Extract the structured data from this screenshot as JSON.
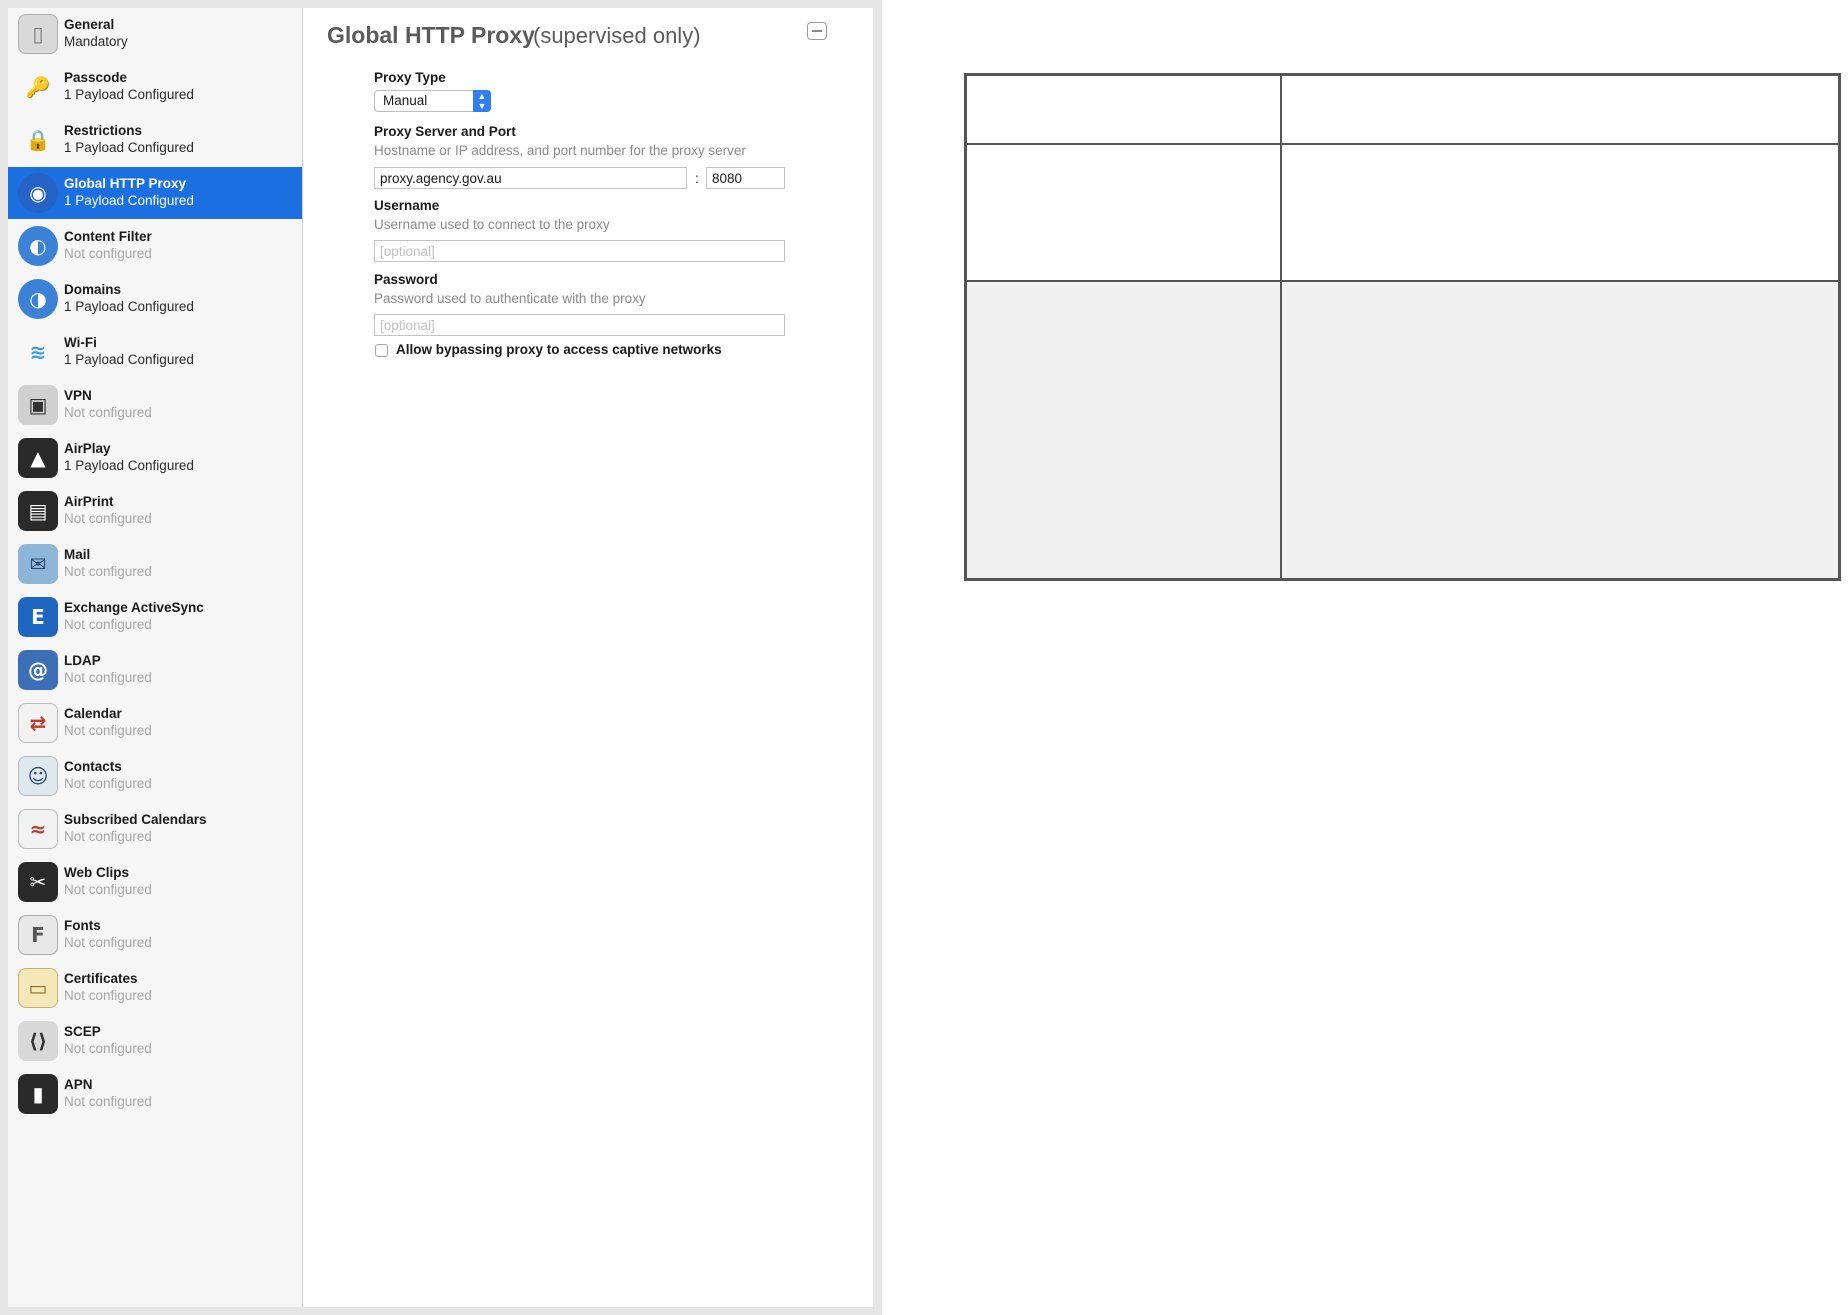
{
  "sidebar": {
    "items": [
      {
        "title": "General",
        "subtitle": "Mandatory",
        "icon": "general-icon",
        "configured": true,
        "selected": false
      },
      {
        "title": "Passcode",
        "subtitle": "1 Payload Configured",
        "icon": "key-icon",
        "configured": true,
        "selected": false
      },
      {
        "title": "Restrictions",
        "subtitle": "1 Payload Configured",
        "icon": "padlock-icon",
        "configured": true,
        "selected": false
      },
      {
        "title": "Global HTTP Proxy",
        "subtitle": "1 Payload Configured",
        "icon": "globe-icon",
        "configured": true,
        "selected": true
      },
      {
        "title": "Content Filter",
        "subtitle": "Not configured",
        "icon": "globe-filter-icon",
        "configured": false,
        "selected": false
      },
      {
        "title": "Domains",
        "subtitle": "1 Payload Configured",
        "icon": "globe-domains-icon",
        "configured": true,
        "selected": false
      },
      {
        "title": "Wi-Fi",
        "subtitle": "1 Payload Configured",
        "icon": "wifi-icon",
        "configured": true,
        "selected": false
      },
      {
        "title": "VPN",
        "subtitle": "Not configured",
        "icon": "vpn-lock-icon",
        "configured": false,
        "selected": false
      },
      {
        "title": "AirPlay",
        "subtitle": "1 Payload Configured",
        "icon": "airplay-icon",
        "configured": true,
        "selected": false
      },
      {
        "title": "AirPrint",
        "subtitle": "Not configured",
        "icon": "printer-icon",
        "configured": false,
        "selected": false
      },
      {
        "title": "Mail",
        "subtitle": "Not configured",
        "icon": "mail-icon",
        "configured": false,
        "selected": false
      },
      {
        "title": "Exchange ActiveSync",
        "subtitle": "Not configured",
        "icon": "exchange-icon",
        "configured": false,
        "selected": false
      },
      {
        "title": "LDAP",
        "subtitle": "Not configured",
        "icon": "ldap-at-icon",
        "configured": false,
        "selected": false
      },
      {
        "title": "Calendar",
        "subtitle": "Not configured",
        "icon": "calendar-icon",
        "configured": false,
        "selected": false
      },
      {
        "title": "Contacts",
        "subtitle": "Not configured",
        "icon": "contacts-icon",
        "configured": false,
        "selected": false
      },
      {
        "title": "Subscribed Calendars",
        "subtitle": "Not configured",
        "icon": "subscribed-calendar-icon",
        "configured": false,
        "selected": false
      },
      {
        "title": "Web Clips",
        "subtitle": "Not configured",
        "icon": "webclip-scissors-icon",
        "configured": false,
        "selected": false
      },
      {
        "title": "Fonts",
        "subtitle": "Not configured",
        "icon": "font-icon",
        "configured": false,
        "selected": false
      },
      {
        "title": "Certificates",
        "subtitle": "Not configured",
        "icon": "certificate-icon",
        "configured": false,
        "selected": false
      },
      {
        "title": "SCEP",
        "subtitle": "Not configured",
        "icon": "scep-lock-icon",
        "configured": false,
        "selected": false
      },
      {
        "title": "APN",
        "subtitle": "Not configured",
        "icon": "apn-icon",
        "configured": false,
        "selected": false
      }
    ]
  },
  "panel": {
    "title": "Global HTTP Proxy",
    "subtitle": "(supervised only)",
    "proxy_type": {
      "label": "Proxy Type",
      "value": "Manual"
    },
    "server": {
      "label": "Proxy Server and Port",
      "hint": "Hostname or IP address, and port number for the proxy server",
      "host_value": "proxy.agency.gov.au",
      "separator": ":",
      "port_value": "8080"
    },
    "username": {
      "label": "Username",
      "hint": "Username used to connect to the proxy",
      "placeholder": "[optional]"
    },
    "password": {
      "label": "Password",
      "hint": "Password used to authenticate with the proxy",
      "placeholder": "[optional]"
    },
    "bypass": {
      "label": "Allow bypassing proxy to access captive networks",
      "checked": false
    }
  },
  "colors": {
    "selection": "#1c6fe0",
    "table_border": "#555555",
    "table_shaded": "#f0f0f0"
  }
}
